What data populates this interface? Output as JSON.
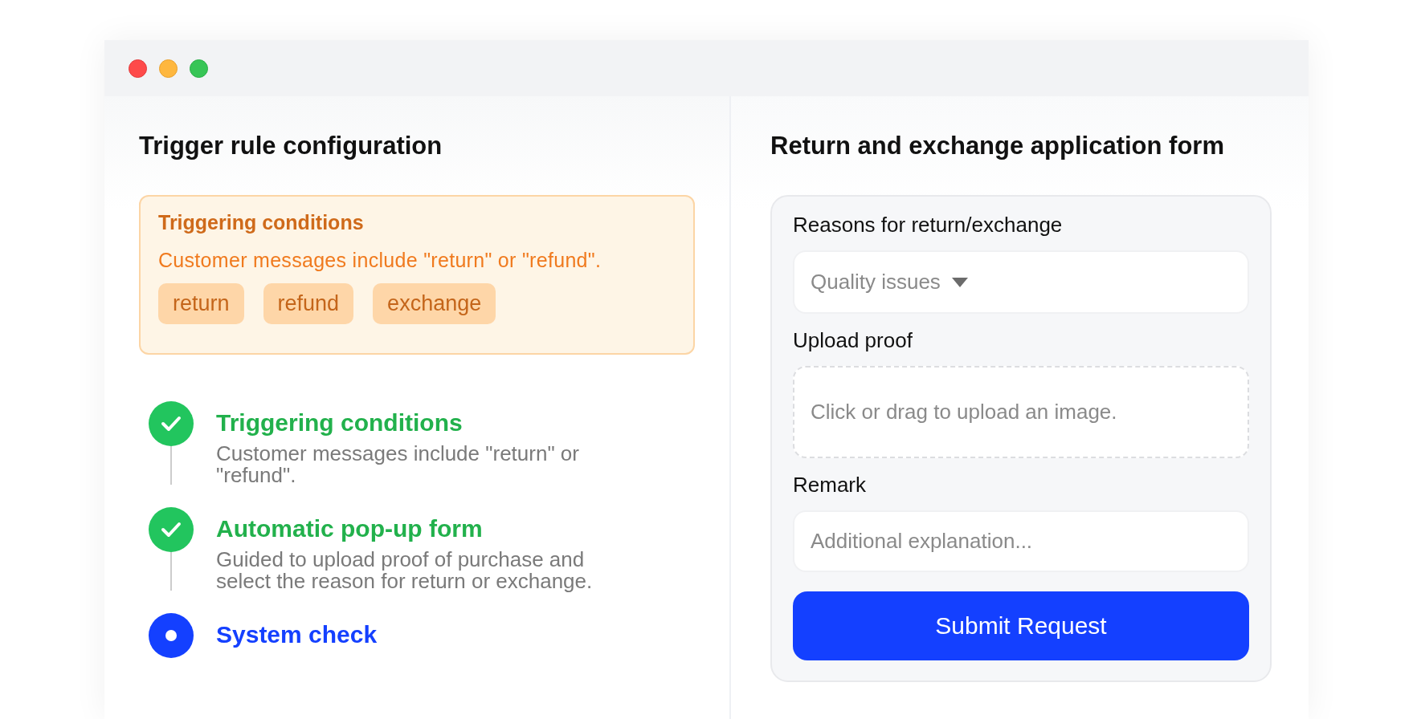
{
  "left_panel": {
    "title": "Trigger rule configuration",
    "condition_card": {
      "title": "Triggering conditions",
      "description": "Customer messages include \"return\" or \"refund\".",
      "keywords": [
        "return",
        "refund",
        "exchange"
      ]
    },
    "steps": [
      {
        "title": "Triggering conditions",
        "description": "Customer messages include \"return\" or \"refund\".",
        "completed": true
      },
      {
        "title": "Automatic pop-up form",
        "description": "Guided to upload proof of purchase and select the reason for return or exchange.",
        "completed": true
      },
      {
        "title": "System check",
        "completed": false
      }
    ]
  },
  "right_panel": {
    "title": "Return and exchange application form",
    "fields": [
      {
        "kind": "select",
        "label": "Reasons for return/exchange",
        "value": "Quality issues"
      },
      {
        "kind": "upload",
        "label": "Upload proof",
        "hint": "Click or drag to upload an image."
      },
      {
        "kind": "text",
        "label": "Remark",
        "placeholder": "Additional explanation..."
      }
    ],
    "submit_button": "Submit Request"
  }
}
